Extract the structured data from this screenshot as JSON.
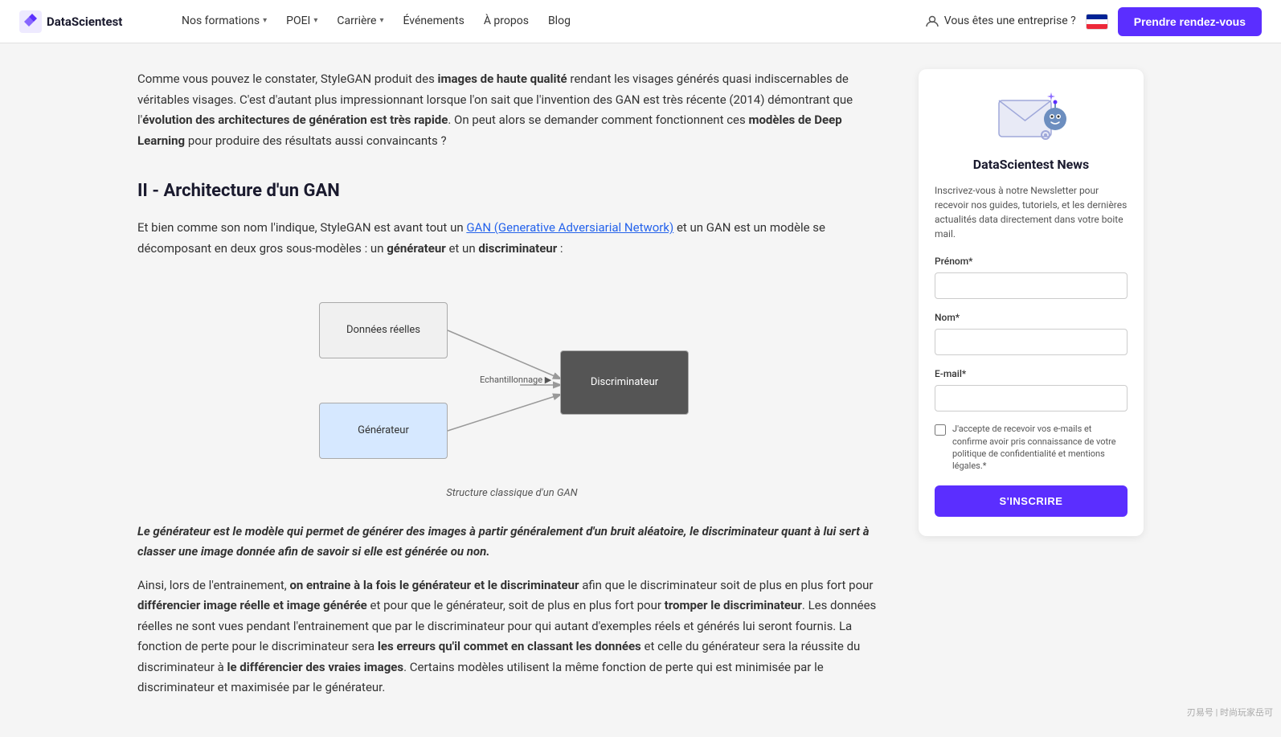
{
  "brand": {
    "name": "DataScientest",
    "logo_alt": "DataScientest logo"
  },
  "nav": {
    "items": [
      {
        "label": "Nos formations",
        "has_dropdown": true
      },
      {
        "label": "POEI",
        "has_dropdown": true
      },
      {
        "label": "Carrière",
        "has_dropdown": true
      },
      {
        "label": "Événements",
        "has_dropdown": false
      },
      {
        "label": "À propos",
        "has_dropdown": false
      },
      {
        "label": "Blog",
        "has_dropdown": false
      }
    ],
    "enterprise_label": "Vous êtes une entreprise ?",
    "cta_label": "Prendre rendez-vous"
  },
  "article": {
    "intro_paragraph": "Comme vous pouvez le constater, StyleGAN produit des ",
    "intro_bold1": "images de haute qualité",
    "intro_mid": " rendant les visages générés quasi indiscernables de véritables visages. C'est d'autant plus impressionnant lorsque l'on sait que l'invention des GAN est très récente (2014) démontrant que l'",
    "intro_bold2": "évolution des architectures de génération est très rapide",
    "intro_end": ". On peut alors se demander comment fonctionnent ces ",
    "intro_bold3": "modèles de Deep Learning",
    "intro_end2": " pour produire des résultats aussi convaincants ?",
    "section_title": "II - Architecture d'un GAN",
    "section_intro": "Et bien comme son nom l'indique, StyleGAN est avant tout un ",
    "section_link": "GAN (Generative Adversiarial Network)",
    "section_mid": " et un GAN est un modèle se décomposant en deux gros sous-modèles : un ",
    "section_bold1": "générateur",
    "section_and": " et un ",
    "section_bold2": "discriminateur",
    "section_colon": " :",
    "diagram": {
      "box_donnees": "Données réelles",
      "box_generateur": "Générateur",
      "box_discriminateur": "Discriminateur",
      "label_echantillonnage": "Echantillonnage",
      "caption": "Structure classique d'un GAN"
    },
    "blockquote": "Le générateur est le modèle qui permet de générer des images à partir généralement d'un bruit aléatoire, le discriminateur quant à lui sert à classer une image donnée afin de savoir si elle est générée ou non.",
    "para2_start": "Ainsi, lors de l'entrainement, ",
    "para2_bold1": "on entraine à la fois le générateur et le discriminateur",
    "para2_mid1": " afin que le discriminateur soit de plus en plus fort pour ",
    "para2_bold2": "différencier image réelle et image générée",
    "para2_mid2": " et pour que le générateur, soit de plus en plus fort pour ",
    "para2_bold3": "tromper le discriminateur",
    "para2_mid3": ". Les données réelles ne sont vues pendant l'entrainement que par le discriminateur pour qui autant d'exemples réels et générés lui seront fournis. La fonction de perte pour le discriminateur sera ",
    "para2_bold4": "les erreurs qu'il commet en classant les données",
    "para2_mid4": " et celle du générateur sera la réussite du discriminateur à ",
    "para2_bold5": "le différencier des vraies images",
    "para2_end": ". Certains modèles utilisent la même fonction de perte qui est minimisée par le discriminateur et maximisée par le générateur."
  },
  "sidebar": {
    "newsletter": {
      "title": "DataScientest News",
      "description": "Inscrivez-vous à notre Newsletter pour recevoir nos guides, tutoriels, et les dernières actualités data directement dans votre boite mail.",
      "prenom_label": "Prénom*",
      "nom_label": "Nom*",
      "email_label": "E-mail*",
      "checkbox_text": "J'accepte de recevoir vos e-mails et confirme avoir pris connaissance de votre politique de confidentialité et mentions légales.*",
      "subscribe_label": "S'INSCRIRE"
    }
  },
  "watermark": "刃易号 | 时尚玩家岳可"
}
